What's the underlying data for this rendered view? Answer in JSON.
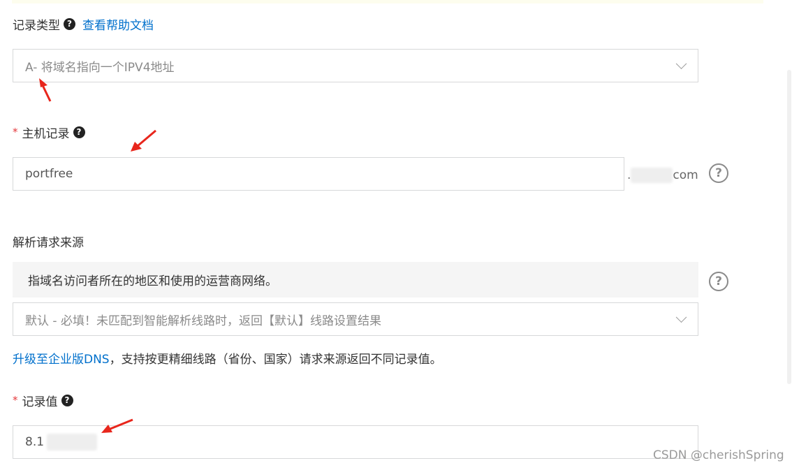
{
  "record_type": {
    "label": "记录类型",
    "help_link": "查看帮助文档",
    "value": "A- 将域名指向一个IPV4地址"
  },
  "host_record": {
    "required_mark": "*",
    "label": "主机记录",
    "value": "portfree",
    "suffix_dot": ".",
    "suffix_tld": "com"
  },
  "source": {
    "label": "解析请求来源",
    "description": "指域名访问者所在的地区和使用的运营商网络。",
    "select_value": "默认 - 必填！未匹配到智能解析线路时，返回【默认】线路设置结果"
  },
  "upgrade": {
    "link_text": "升级至企业版DNS",
    "rest_text": "，支持按更精细线路（省份、国家）请求来源返回不同记录值。"
  },
  "record_value": {
    "required_mark": "*",
    "label": "记录值",
    "value": "8.1"
  },
  "help_glyph": "?",
  "watermark": "CSDN @cherishSpring",
  "colors": {
    "link": "#0070cc",
    "required": "#e4393c",
    "arrow": "#e8261c"
  }
}
